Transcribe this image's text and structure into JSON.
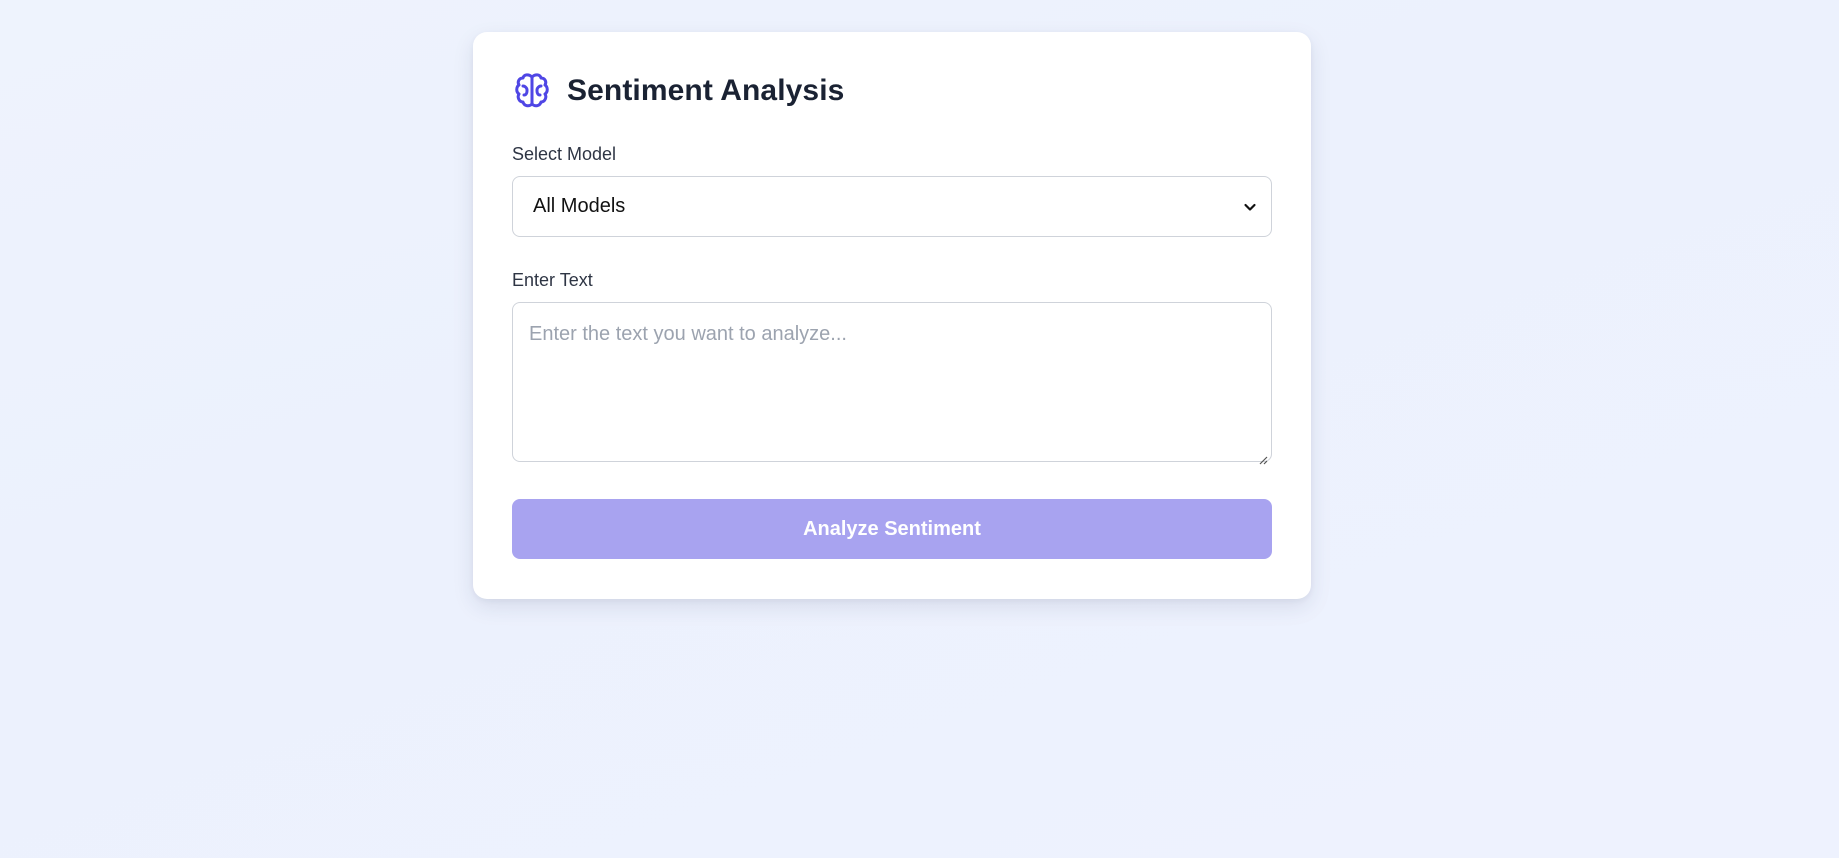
{
  "header": {
    "title": "Sentiment Analysis",
    "icon": "brain-icon"
  },
  "model_select": {
    "label": "Select Model",
    "selected": "All Models",
    "icon": "chevron-down-icon"
  },
  "text_input": {
    "label": "Enter Text",
    "placeholder": "Enter the text you want to analyze...",
    "value": ""
  },
  "actions": {
    "analyze_label": "Analyze Sentiment",
    "analyze_disabled": true
  },
  "colors": {
    "accent": "#4f46e5",
    "button_disabled": "#a8a3f0",
    "page_background": "#edf2fd",
    "card_background": "#ffffff"
  }
}
